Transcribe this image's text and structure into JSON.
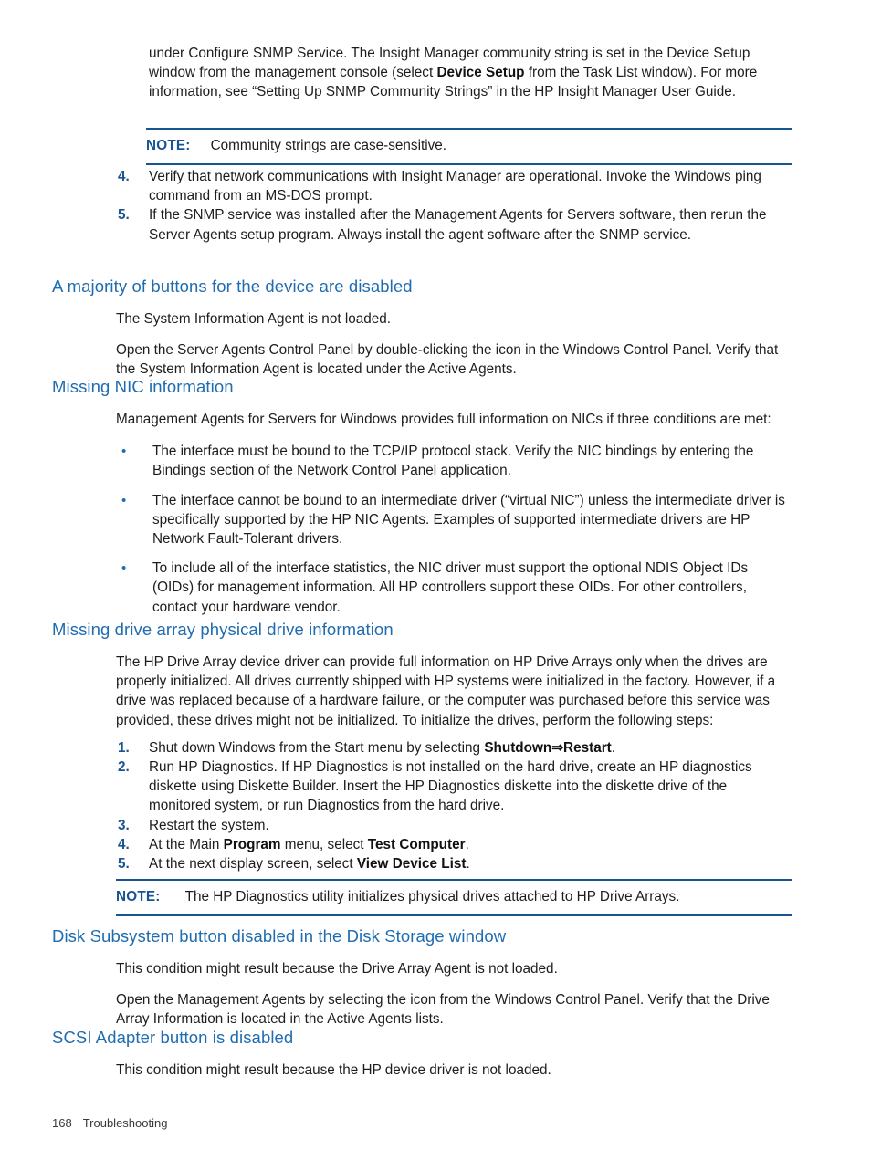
{
  "document": {
    "intro_paragraph": {
      "part1": "under Configure SNMP Service. The Insight Manager community string is set in the Device Setup window from the management console (select ",
      "bold1": "Device Setup",
      "part2": " from the Task List window). For more information, see “Setting Up SNMP Community Strings” in the HP Insight Manager User Guide."
    },
    "note1": {
      "label": "NOTE:",
      "text": "Community strings are case-sensitive."
    },
    "top_steps": [
      {
        "number": "4.",
        "text": "Verify that network communications with Insight Manager are operational. Invoke the Windows ping command from an MS-DOS prompt."
      },
      {
        "number": "5.",
        "text": "If the SNMP service was installed after the Management Agents for Servers software, then rerun the Server Agents setup program. Always install the agent software after the SNMP service."
      }
    ],
    "sections": [
      {
        "heading": "A majority of buttons for the device are disabled",
        "paragraphs": [
          "The System Information Agent is not loaded.",
          "Open the Server Agents Control Panel by double-clicking the icon in the Windows Control Panel. Verify that the System Information Agent is located under the Active Agents."
        ]
      },
      {
        "heading": "Missing NIC information",
        "paragraphs": [
          "Management Agents for Servers for Windows provides full information on NICs if three conditions are met:"
        ],
        "bullets": [
          "The interface must be bound to the TCP/IP protocol stack. Verify the NIC bindings by entering the Bindings section of the Network Control Panel application.",
          "The interface cannot be bound to an intermediate driver (“virtual NIC”) unless the intermediate driver is specifically supported by the HP NIC Agents. Examples of supported intermediate drivers are HP Network Fault-Tolerant drivers.",
          "To include all of the interface statistics, the NIC driver must support the optional NDIS Object IDs (OIDs) for management information. All HP controllers support these OIDs. For other controllers, contact your hardware vendor."
        ]
      },
      {
        "heading": "Missing drive array physical drive information",
        "paragraphs": [
          "The HP Drive Array device driver can provide full information on HP Drive Arrays only when the drives are properly initialized. All drives currently shipped with HP systems were initialized in the factory. However, if a drive was replaced because of a hardware failure, or the computer was purchased before this service was provided, these drives might not be initialized. To initialize the drives, perform the following steps:"
        ]
      },
      {
        "heading": "Disk Subsystem button disabled in the Disk Storage window",
        "paragraphs": [
          "This condition might result because the Drive Array Agent is not loaded.",
          "Open the Management Agents by selecting the icon from the Windows Control Panel. Verify that the Drive Array Information is located in the Active Agents lists."
        ]
      },
      {
        "heading": "SCSI Adapter button is disabled",
        "paragraphs": [
          "This condition might result because the HP device driver is not loaded."
        ]
      }
    ],
    "drive_steps": [
      {
        "number": "1.",
        "pre": "Shut down Windows from the Start menu by selecting ",
        "bold": "Shutdown⇒Restart",
        "post": "."
      },
      {
        "number": "2.",
        "pre": "Run HP Diagnostics. If HP Diagnostics is not installed on the hard drive, create an HP diagnostics diskette using Diskette Builder. Insert the HP Diagnostics diskette into the diskette drive of the monitored system, or run Diagnostics from the hard drive.",
        "bold": "",
        "post": ""
      },
      {
        "number": "3.",
        "pre": "Restart the system.",
        "bold": "",
        "post": ""
      },
      {
        "number": "4.",
        "pre": "At the Main ",
        "bold": "Program",
        "post": " menu, select ",
        "bold2": "Test Computer",
        "post2": "."
      },
      {
        "number": "5.",
        "pre": "At the next display screen, select ",
        "bold": "View Device List",
        "post": "."
      }
    ],
    "note2": {
      "label": "NOTE:",
      "text": "The HP Diagnostics utility initializes physical drives attached to HP Drive Arrays."
    },
    "footer": {
      "page_number": "168",
      "chapter": "Troubleshooting"
    },
    "colors": {
      "heading_blue": "#1f6cb0",
      "note_blue": "#1a5490",
      "rule_blue": "#16558f",
      "body_text": "#1d1d1d"
    },
    "bullet_glyph": "•"
  }
}
